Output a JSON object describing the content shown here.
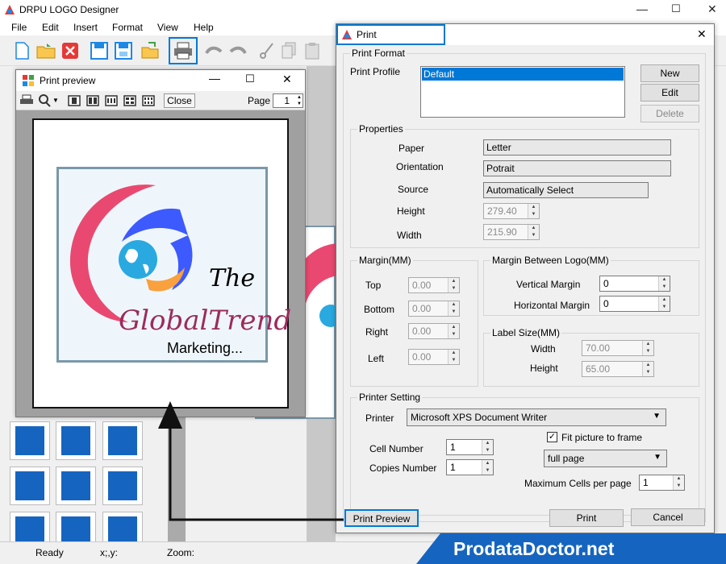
{
  "app": {
    "title": "DRPU LOGO Designer",
    "controls": {
      "min": "—",
      "max": "☐",
      "close": "✕"
    }
  },
  "menu": [
    "File",
    "Edit",
    "Insert",
    "Format",
    "View",
    "Help"
  ],
  "preview": {
    "title": "Print preview",
    "close_label": "Close",
    "page_label": "Page",
    "page_value": "1",
    "logo": {
      "line1": "The",
      "line2": "GlobalTrend",
      "line3": "Marketing..."
    }
  },
  "print": {
    "title": "Print",
    "format_group": "Print Format",
    "profile_label": "Print Profile",
    "profiles": [
      "Default"
    ],
    "new_label": "New",
    "edit_label": "Edit",
    "delete_label": "Delete",
    "properties_group": "Properties",
    "paper_label": "Paper",
    "paper": "Letter",
    "orientation_label": "Orientation",
    "orientation": "Potrait",
    "source_label": "Source",
    "source": "Automatically Select",
    "height_label": "Height",
    "height": "279.40",
    "width_label": "Width",
    "width": "215.90",
    "margin_group": "Margin(MM)",
    "top_label": "Top",
    "top": "0.00",
    "bottom_label": "Bottom",
    "bottom": "0.00",
    "right_label": "Right",
    "right": "0.00",
    "left_label": "Left",
    "left": "0.00",
    "mbl_group": "Margin Between Logo(MM)",
    "vmargin_label": "Vertical Margin",
    "vmargin": "0",
    "hmargin_label": "Horizontal Margin",
    "hmargin": "0",
    "label_group": "Label Size(MM)",
    "lwidth_label": "Width",
    "lwidth": "70.00",
    "lheight_label": "Height",
    "lheight": "65.00",
    "printer_group": "Printer Setting",
    "printer_label": "Printer",
    "printer": "Microsoft XPS Document Writer",
    "cell_label": "Cell Number",
    "cell": "1",
    "copies_label": "Copies Number",
    "copies": "1",
    "fit_label": "Fit picture to frame",
    "fit_mode": "full page",
    "maxcells_label": "Maximum Cells per page",
    "maxcells": "1",
    "preview_btn": "Print Preview",
    "print_btn": "Print",
    "cancel_btn": "Cancel"
  },
  "status": {
    "ready": "Ready",
    "xy": "x;,y:",
    "zoom": "Zoom:"
  },
  "watermark": "ProdataDoctor.net",
  "colors": {
    "highlight": "#0078d7",
    "logo_frame": "#7a98a8",
    "watermark_bg": "#1565c0"
  }
}
